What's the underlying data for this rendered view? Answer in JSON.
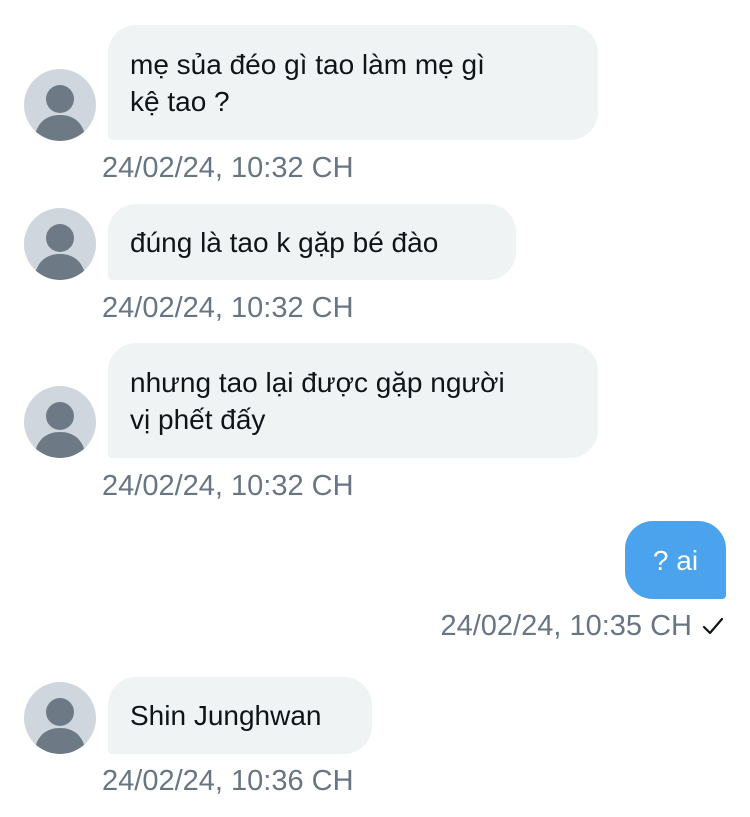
{
  "messages": [
    {
      "direction": "incoming",
      "text": "mẹ sủa đéo gì tao làm mẹ gì\nkệ tao ?",
      "time": "24/02/24, 10:32 CH",
      "avatar_icon": "default-user-icon"
    },
    {
      "direction": "incoming",
      "text": "đúng là tao k gặp bé đào",
      "time": "24/02/24, 10:32 CH",
      "avatar_icon": "default-user-icon"
    },
    {
      "direction": "incoming",
      "text": "nhưng tao lại được gặp người\nvị phết đấy",
      "time": "24/02/24, 10:32 CH",
      "avatar_icon": "default-user-icon"
    },
    {
      "direction": "outgoing",
      "text": "? ai",
      "time": "24/02/24, 10:35 CH",
      "status_icon": "check-icon"
    },
    {
      "direction": "incoming",
      "text": "Shin Junghwan",
      "time": "24/02/24, 10:36 CH",
      "avatar_icon": "default-user-icon"
    }
  ],
  "colors": {
    "incoming_bubble": "#eff3f4",
    "outgoing_bubble": "#4aa3ec",
    "timestamp": "#687684",
    "avatar_bg": "#cfd6dd",
    "avatar_figure": "#6d7a86"
  }
}
